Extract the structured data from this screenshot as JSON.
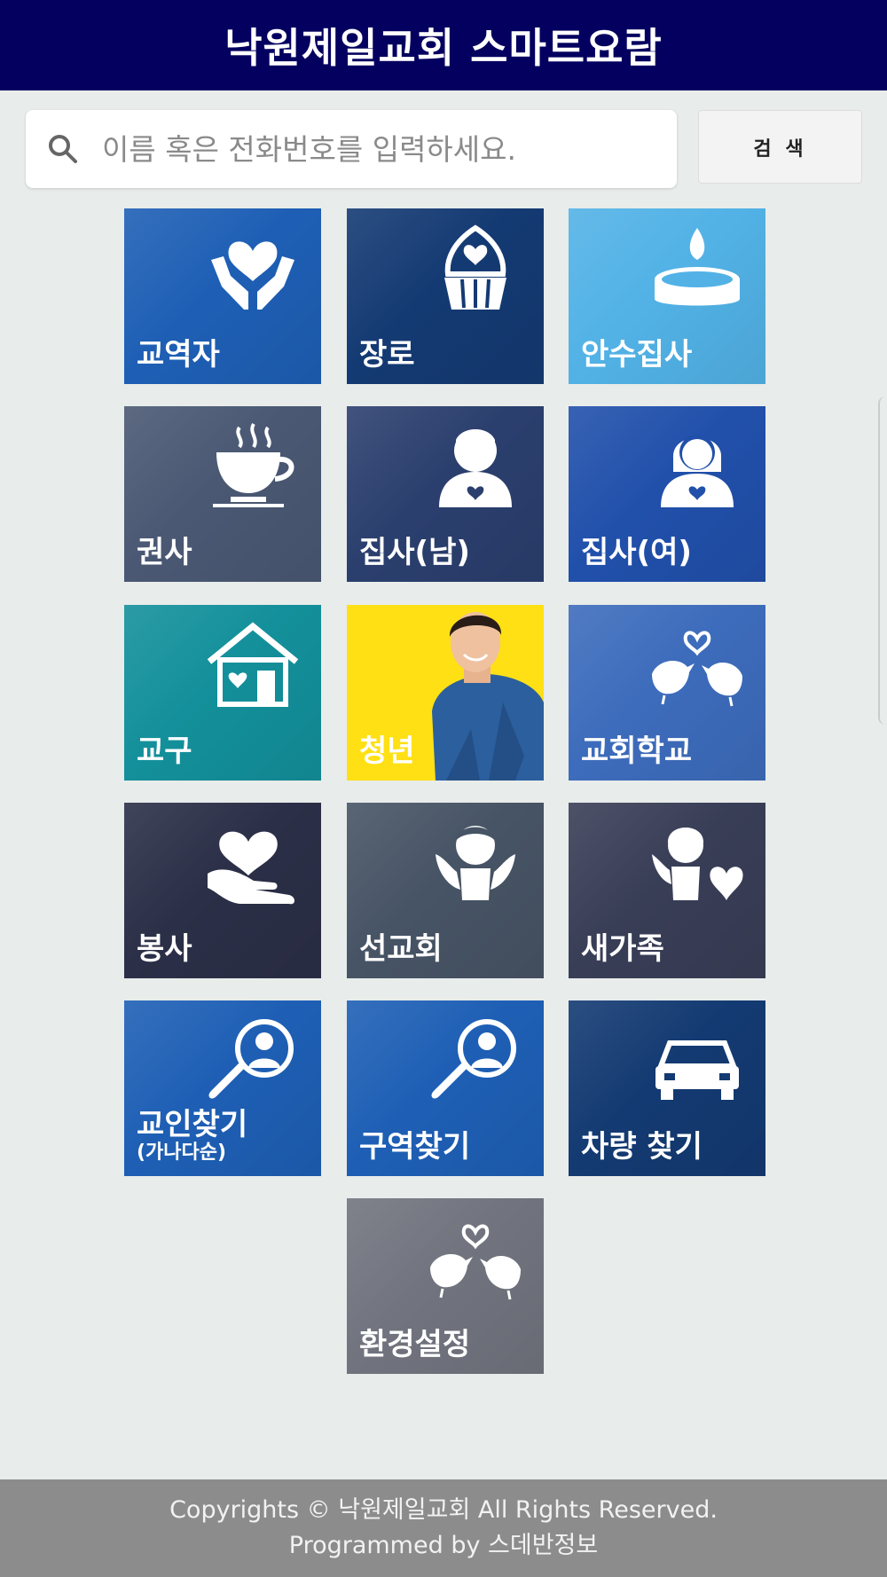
{
  "header": {
    "title": "낙원제일교회 스마트요람"
  },
  "search": {
    "placeholder": "이름 혹은 전화번호를 입력하세요.",
    "value": "",
    "button_label": "검 색",
    "icon": "search-icon"
  },
  "tiles": [
    {
      "label": "교역자",
      "icon": "hands-heart-icon",
      "color": "#1e5fb5"
    },
    {
      "label": "장로",
      "icon": "cupcake-heart-icon",
      "color": "#143a73"
    },
    {
      "label": "안수집사",
      "icon": "candle-icon",
      "color": "#52b2e6"
    },
    {
      "label": "권사",
      "icon": "coffee-cup-icon",
      "color": "#4a5873"
    },
    {
      "label": "집사(남)",
      "icon": "man-heart-icon",
      "color": "#2b3f6e"
    },
    {
      "label": "집사(여)",
      "icon": "woman-heart-icon",
      "color": "#2150ab"
    },
    {
      "label": "교구",
      "icon": "house-heart-icon",
      "color": "#13909b"
    },
    {
      "label": "청년",
      "icon": "young-man-photo",
      "color": "#ffe015"
    },
    {
      "label": "교회학교",
      "icon": "birds-heart-icon",
      "color": "#3d6cbc"
    },
    {
      "label": "봉사",
      "icon": "hand-heart-icon",
      "color": "#2b2f47"
    },
    {
      "label": "선교회",
      "icon": "angel-icon",
      "color": "#475465"
    },
    {
      "label": "새가족",
      "icon": "cupid-heart-icon",
      "color": "#393e57"
    },
    {
      "label": "교인찾기",
      "sublabel": "(가나다순)",
      "icon": "magnifier-person-icon",
      "color": "#1e5fb5"
    },
    {
      "label": "구역찾기",
      "icon": "magnifier-person-icon",
      "color": "#1e5fb5"
    },
    {
      "label": "차량 찾기",
      "icon": "car-icon",
      "color": "#133a72"
    },
    {
      "label": "환경설정",
      "icon": "birds-heart-icon",
      "color": "#71747e"
    }
  ],
  "footer": {
    "line1": "Copyrights © 낙원제일교회 All Rights Reserved.",
    "line2": "Programmed by 스데반정보"
  }
}
